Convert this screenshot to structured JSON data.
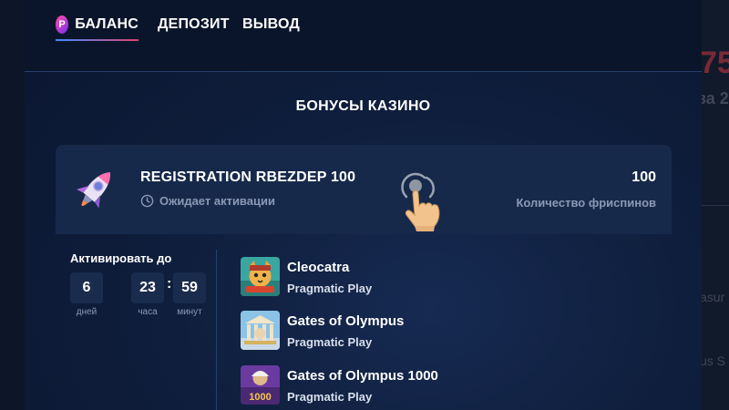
{
  "background_page": {
    "number_fragment": "75",
    "subtitle_fragment": "за 2",
    "text_fragment_1": "asur",
    "text_fragment_2": "us S"
  },
  "header": {
    "tabs": [
      {
        "label": "БАЛАНС",
        "active": true,
        "logo_letter": "P"
      },
      {
        "label": "ДЕПОЗИТ",
        "active": false
      },
      {
        "label": "ВЫВОД",
        "active": false
      }
    ]
  },
  "section_title": "БОНУСЫ КАЗИНО",
  "bonus": {
    "name": "REGISTRATION RBEZDEP 100",
    "status": "Ожидает активации",
    "freespins_count": "100",
    "freespins_label": "Количество фриспинов",
    "icon": "rocket-icon"
  },
  "activation": {
    "label": "Активировать до",
    "days": "6",
    "hours": "23",
    "minutes": "59",
    "separator": ":",
    "days_unit": "дней",
    "hours_unit": "часа",
    "minutes_unit": "минут"
  },
  "games": [
    {
      "name": "Cleocatra",
      "provider": "Pragmatic Play"
    },
    {
      "name": "Gates of Olympus",
      "provider": "Pragmatic Play"
    },
    {
      "name": "Gates of Olympus 1000",
      "provider": "Pragmatic Play",
      "thumb_text": "1000"
    }
  ],
  "colors": {
    "accent_gradient_start": "#3b8cff",
    "accent_gradient_end": "#e0446d",
    "card_background": "#17294a",
    "muted_text": "#8a99b6"
  }
}
